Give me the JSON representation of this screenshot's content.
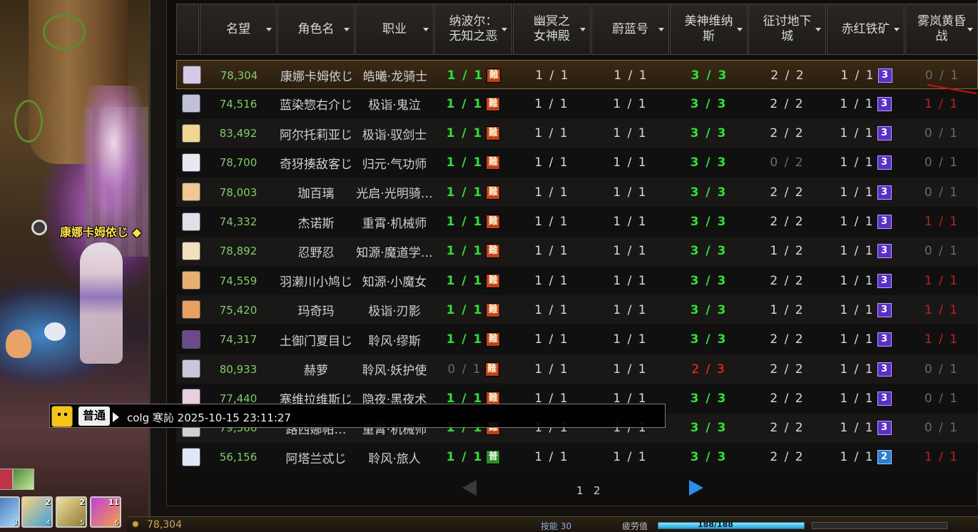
{
  "scene": {
    "character_name": "康娜卡姆依じ ◆",
    "skill_slots": [
      {
        "count": "",
        "key": "3"
      },
      {
        "count": "2",
        "key": "4"
      },
      {
        "count": "2",
        "key": "5"
      },
      {
        "count": "11",
        "key": "6"
      }
    ]
  },
  "table": {
    "headers": [
      "名望",
      "角色名",
      "职业",
      "纳波尔：\n无知之恶",
      "幽冥之\n女神殿",
      "蔚蓝号",
      "美神维纳\n斯",
      "征讨地下\n城",
      "赤红铁矿",
      "雾岚黄昏\n战"
    ],
    "rows": [
      {
        "fame": "78,304",
        "name": "康娜卡姆依じ",
        "job": "皓曦·龙骑士",
        "c1": "1 / 1",
        "c1_badge": "難",
        "c2": "1 / 1",
        "c3": "1 / 1",
        "c4": "3 / 3",
        "c5": "2 / 2",
        "c6": "1 / 1",
        "c6_badge": "3",
        "c7": "0 / 1"
      },
      {
        "fame": "74,516",
        "name": "蓝染惣右介じ",
        "job": "极诣·鬼泣",
        "c1": "1 / 1",
        "c1_badge": "難",
        "c2": "1 / 1",
        "c3": "1 / 1",
        "c4": "3 / 3",
        "c5": "2 / 2",
        "c6": "1 / 1",
        "c6_badge": "3",
        "c7": "1 / 1"
      },
      {
        "fame": "83,492",
        "name": "阿尔托莉亚じ",
        "job": "极诣·驭剑士",
        "c1": "1 / 1",
        "c1_badge": "難",
        "c2": "1 / 1",
        "c3": "1 / 1",
        "c4": "3 / 3",
        "c5": "2 / 2",
        "c6": "1 / 1",
        "c6_badge": "3",
        "c7": "0 / 1"
      },
      {
        "fame": "78,700",
        "name": "奇犽揍敌客じ",
        "job": "归元·气功师",
        "c1": "1 / 1",
        "c1_badge": "難",
        "c2": "1 / 1",
        "c3": "1 / 1",
        "c4": "3 / 3",
        "c5": "0 / 2",
        "c6": "1 / 1",
        "c6_badge": "3",
        "c7": "0 / 1"
      },
      {
        "fame": "78,003",
        "name": "珈百璃",
        "job": "光启·光明骑…",
        "c1": "1 / 1",
        "c1_badge": "難",
        "c2": "1 / 1",
        "c3": "1 / 1",
        "c4": "3 / 3",
        "c5": "2 / 2",
        "c6": "1 / 1",
        "c6_badge": "3",
        "c7": "0 / 1"
      },
      {
        "fame": "74,332",
        "name": "杰诺斯",
        "job": "重霄·机械师",
        "c1": "1 / 1",
        "c1_badge": "難",
        "c2": "1 / 1",
        "c3": "1 / 1",
        "c4": "3 / 3",
        "c5": "2 / 2",
        "c6": "1 / 1",
        "c6_badge": "3",
        "c7": "1 / 1"
      },
      {
        "fame": "78,892",
        "name": "忍野忍",
        "job": "知源·魔道学…",
        "c1": "1 / 1",
        "c1_badge": "難",
        "c2": "1 / 1",
        "c3": "1 / 1",
        "c4": "3 / 3",
        "c5": "1 / 2",
        "c6": "1 / 1",
        "c6_badge": "3",
        "c7": "0 / 1"
      },
      {
        "fame": "74,559",
        "name": "羽濑川小鸠じ",
        "job": "知源·小魔女",
        "c1": "1 / 1",
        "c1_badge": "難",
        "c2": "1 / 1",
        "c3": "1 / 1",
        "c4": "3 / 3",
        "c5": "2 / 2",
        "c6": "1 / 1",
        "c6_badge": "3",
        "c7": "1 / 1"
      },
      {
        "fame": "75,420",
        "name": "玛奇玛",
        "job": "极诣·刃影",
        "c1": "1 / 1",
        "c1_badge": "難",
        "c2": "1 / 1",
        "c3": "1 / 1",
        "c4": "3 / 3",
        "c5": "1 / 2",
        "c6": "1 / 1",
        "c6_badge": "3",
        "c7": "1 / 1"
      },
      {
        "fame": "74,317",
        "name": "土御门夏目じ",
        "job": "聆风·缪斯",
        "c1": "1 / 1",
        "c1_badge": "難",
        "c2": "1 / 1",
        "c3": "1 / 1",
        "c4": "3 / 3",
        "c5": "2 / 2",
        "c6": "1 / 1",
        "c6_badge": "3",
        "c7": "1 / 1"
      },
      {
        "fame": "80,933",
        "name": "赫萝",
        "job": "聆风·妖护使",
        "c1": "0 / 1",
        "c1_badge": "難",
        "c2": "1 / 1",
        "c3": "1 / 1",
        "c4": "2 / 3",
        "c5": "2 / 2",
        "c6": "1 / 1",
        "c6_badge": "3",
        "c7": "0 / 1"
      },
      {
        "fame": "77,440",
        "name": "塞维拉维斯じ",
        "job": "隐夜·黑夜术",
        "c1": "1 / 1",
        "c1_badge": "難",
        "c2": "1 / 1",
        "c3": "1 / 1",
        "c4": "3 / 3",
        "c5": "2 / 2",
        "c6": "1 / 1",
        "c6_badge": "3",
        "c7": "0 / 1"
      },
      {
        "fame": "79,566",
        "name": "路西娜帕…",
        "job": "重霄·机械师",
        "c1": "1 / 1",
        "c1_badge": "難",
        "c2": "1 / 1",
        "c3": "1 / 1",
        "c4": "3 / 3",
        "c5": "2 / 2",
        "c6": "1 / 1",
        "c6_badge": "3",
        "c7": "0 / 1"
      },
      {
        "fame": "56,156",
        "name": "阿塔兰忒じ",
        "job": "聆风·旅人",
        "c1": "1 / 1",
        "c1_badge": "普",
        "c2": "1 / 1",
        "c3": "1 / 1",
        "c4": "3 / 3",
        "c5": "2 / 2",
        "c6": "1 / 1",
        "c6_badge": "2",
        "c7": "1 / 1"
      }
    ]
  },
  "chat": {
    "channel": "普通",
    "message": "colg 寒訫 2025-10-15 23:11:27"
  },
  "pagination": {
    "pages": [
      "1",
      "2"
    ]
  },
  "statusbar": {
    "fame": "78,304",
    "mp_label": "按能 30",
    "fatigue_label": "疲劳值",
    "fatigue_text": "188/188",
    "fatigue_fraction": 1.0
  },
  "colors": {
    "green": "#2fe03a",
    "red": "#ff2a2a",
    "gray": "#6a6a6a",
    "fame_green": "#7fcc6a",
    "badge_hard": "#c0401a",
    "badge_normal": "#2e8a2a",
    "badge_num": "#5a2fc8",
    "page_arrow_active": "#2a8fe6",
    "page_arrow_inactive": "#3a3a3a"
  }
}
